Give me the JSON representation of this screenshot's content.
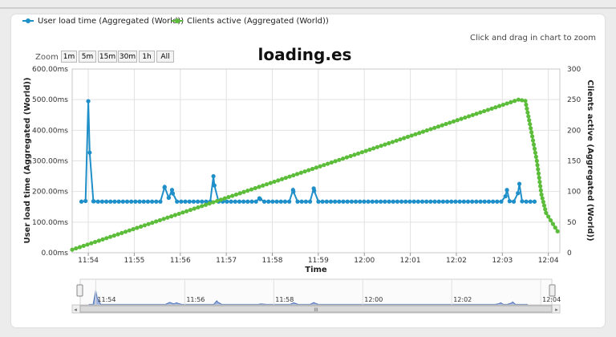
{
  "legend": [
    {
      "name": "User load time (Aggregated (World))",
      "color": "#1f8fc9"
    },
    {
      "name": "Clients active (Aggregated (World))",
      "color": "#5cbd3a"
    }
  ],
  "zoom_hint": "Click and drag in chart to zoom",
  "zoom": {
    "label": "Zoom",
    "buttons": [
      "1m",
      "5m",
      "15m",
      "30m",
      "1h",
      "All"
    ]
  },
  "chart_data": {
    "type": "line",
    "title": "loading.es",
    "xlabel": "Time",
    "ylabel_left": "User load time (Aggregated (World))",
    "ylabel_right": "Clients active (Aggregated (World))",
    "x_ticks": [
      "11:54",
      "11:55",
      "11:56",
      "11:57",
      "11:58",
      "11:59",
      "12:00",
      "12:01",
      "12:02",
      "12:03",
      "12:04"
    ],
    "x_range_minutes": [
      -0.35,
      10.25
    ],
    "y_left": {
      "ylim": [
        0,
        600
      ],
      "ticks": [
        "0.00ms",
        "100.00ms",
        "200.00ms",
        "300.00ms",
        "400.00ms",
        "500.00ms",
        "600.00ms"
      ]
    },
    "y_right": {
      "ylim": [
        0,
        300
      ],
      "ticks": [
        "0",
        "50",
        "100",
        "150",
        "200",
        "250",
        "300"
      ]
    },
    "grid": true,
    "legend_position": "top-left",
    "series": [
      {
        "name": "User load time (Aggregated (World))",
        "axis": "left",
        "unit": "ms",
        "color": "#1f8fc9",
        "baseline_ms": 167,
        "x_min_start": -0.15,
        "x_min_end": 9.7,
        "points_count": 110,
        "spikes": [
          {
            "x": 0.0,
            "y": 495
          },
          {
            "x": 0.11,
            "y": 168
          },
          {
            "x": 1.66,
            "y": 215
          },
          {
            "x": 1.75,
            "y": 180
          },
          {
            "x": 1.82,
            "y": 205
          },
          {
            "x": 2.72,
            "y": 250
          },
          {
            "x": 3.72,
            "y": 178
          },
          {
            "x": 4.45,
            "y": 205
          },
          {
            "x": 4.9,
            "y": 210
          },
          {
            "x": 9.1,
            "y": 205
          },
          {
            "x": 9.37,
            "y": 225
          }
        ]
      },
      {
        "name": "Clients active (Aggregated (World))",
        "axis": "right",
        "color": "#5cbd3a",
        "points": [
          [
            -0.35,
            5
          ],
          [
            9.35,
            250
          ],
          [
            9.5,
            248
          ],
          [
            9.6,
            210
          ],
          [
            9.75,
            150
          ],
          [
            9.85,
            95
          ],
          [
            9.95,
            65
          ],
          [
            10.2,
            35
          ]
        ]
      }
    ]
  },
  "navigator": {
    "ticks": [
      "11:54",
      "11:56",
      "11:58",
      "12:00",
      "12:02",
      "12:04"
    ],
    "scroll_label": "III"
  }
}
